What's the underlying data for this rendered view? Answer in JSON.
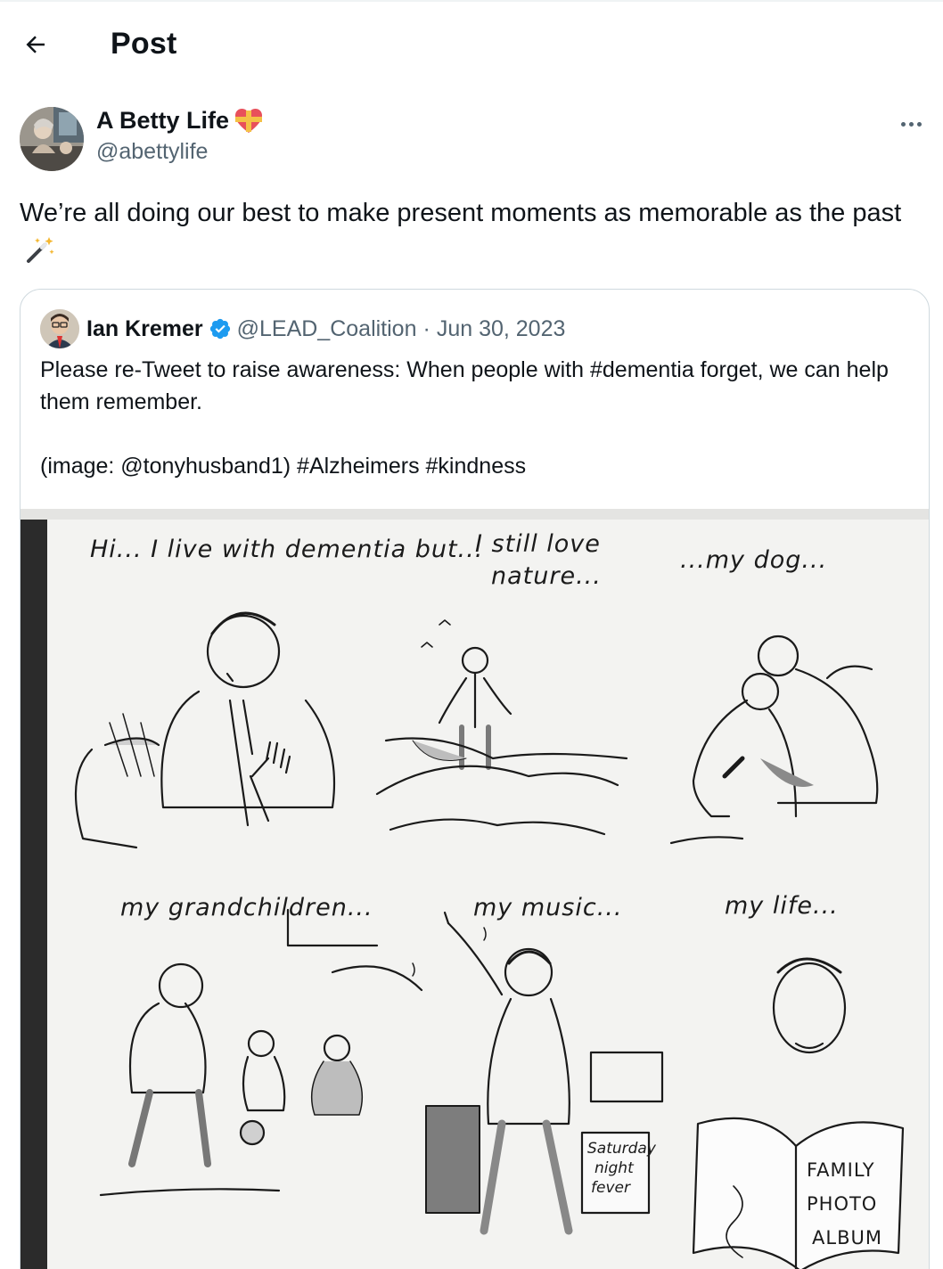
{
  "header": {
    "title": "Post",
    "back_icon": "arrow-left-icon"
  },
  "author": {
    "display_name": "A Betty Life",
    "name_emoji": "heart-with-ribbon-icon",
    "handle": "@abettylife"
  },
  "post": {
    "text": "We’re all doing our best to make present moments as memorable as the past",
    "trailing_emoji": "magic-wand-icon"
  },
  "quoted_post": {
    "display_name": "Ian Kremer",
    "verified": true,
    "handle": "@LEAD_Coalition",
    "separator": "·",
    "date": "Jun 30, 2023",
    "text_line1": "Please re-Tweet to raise awareness: When people with #dementia forget, we can help them remember.",
    "text_line2": "(image: @tonyhusband1) #Alzheimers #kindness"
  },
  "cartoon": {
    "captions": {
      "panel1": "Hi... I live with dementia but...",
      "panel2_a": "I still love",
      "panel2_b": "nature...",
      "panel3": "...my dog...",
      "panel4": "my grandchildren...",
      "panel5": "my music...",
      "panel6": "my life..."
    },
    "record_label_1": "Saturday",
    "record_label_2": "night",
    "record_label_3": "fever",
    "album_1": "FAMILY",
    "album_2": "PHOTO",
    "album_3": "ALBUM"
  },
  "colors": {
    "text_primary": "#0f1419",
    "text_secondary": "#536471",
    "verified_blue": "#1d9bf0",
    "card_border": "#cfd9de"
  }
}
